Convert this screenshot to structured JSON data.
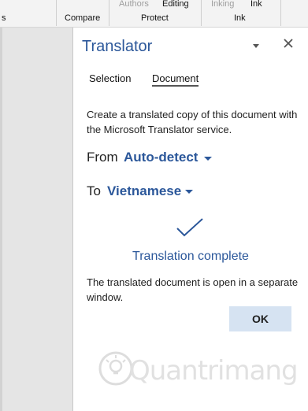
{
  "ribbon": {
    "group_s_label": "s",
    "compare_label": "Compare",
    "authors_label": "Authors",
    "editing_label": "Editing",
    "protect_label": "Protect",
    "inking_label": "Inking",
    "ink_top_label": "Ink",
    "ink_label": "Ink"
  },
  "pane": {
    "title": "Translator",
    "menu_icon": "chevron-down-icon",
    "close_icon": "close-icon",
    "tabs": [
      {
        "label": "Selection"
      },
      {
        "label": "Document"
      }
    ],
    "description": "Create a translated copy of this document with the Microsoft Translator service.",
    "from_label": "From",
    "from_value": "Auto-detect",
    "to_label": "To",
    "to_value": "Vietnamese",
    "status": "Translation complete",
    "note": "The translated document is open in a separate window.",
    "ok_label": "OK",
    "accent": "#2b579a"
  },
  "watermark": {
    "text": "Quantrimang",
    "icon": "lightbulb-logo"
  }
}
